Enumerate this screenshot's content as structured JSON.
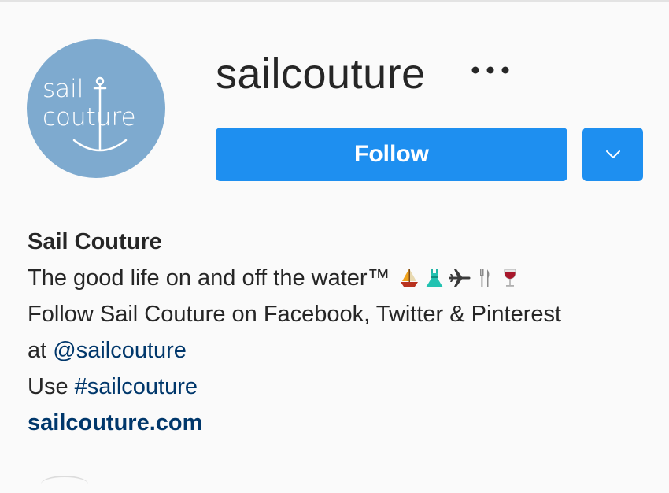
{
  "profile": {
    "avatar_text_line1": "sail",
    "avatar_text_line2": "couture",
    "username": "sailcouture",
    "more_label": "•••",
    "follow_label": "Follow",
    "colors": {
      "avatar_bg": "#7eaacf",
      "button_blue": "#1e8ff0",
      "link_blue": "#00376b"
    }
  },
  "bio": {
    "full_name": "Sail Couture",
    "tagline": "The good life on and off the water™",
    "emojis": [
      "sailboat-icon",
      "dress-icon",
      "airplane-icon",
      "fork-knife-icon",
      "wine-glass-icon"
    ],
    "follow_text": "Follow Sail Couture on Facebook, Twitter & Pinterest",
    "at_prefix": "at",
    "mention": "@sailcouture",
    "use_prefix": "Use",
    "hashtag": "#sailcouture",
    "website": "sailcouture.com"
  }
}
